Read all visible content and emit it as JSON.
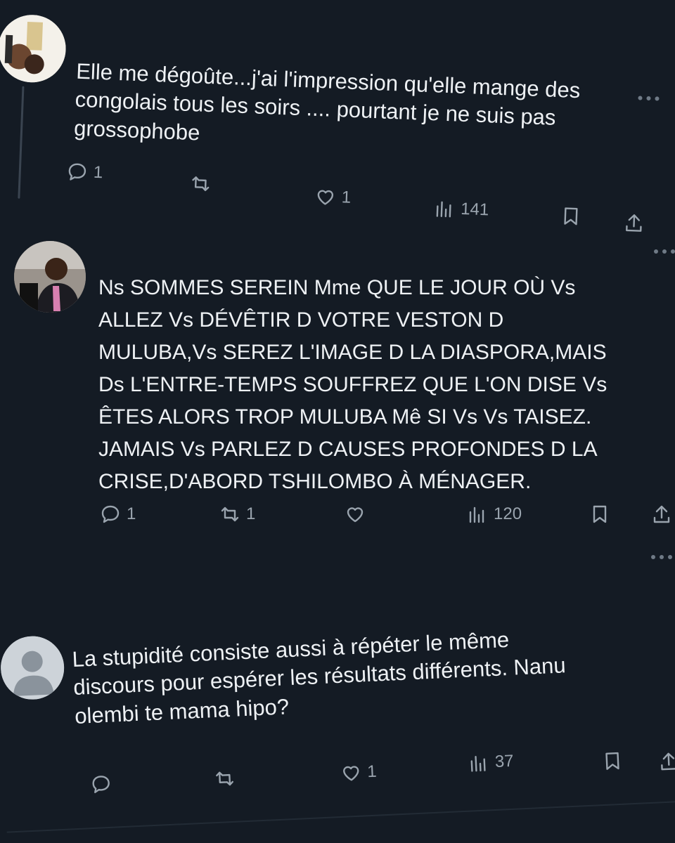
{
  "colors": {
    "background": "#141b24",
    "text": "#eef1f4",
    "icon": "#9aa4ae",
    "thread_line": "#3a4450"
  },
  "posts": [
    {
      "text": "Elle me dégoûte...j'ai l'impression qu'elle mange des\ncongolais tous les soirs .... pourtant je ne suis pas\ngrossophobe",
      "actions": {
        "reply_icon": "speech-bubble-icon",
        "reply_count": "1",
        "repost_icon": "repost-arrows-icon",
        "repost_count": "",
        "like_icon": "heart-icon",
        "like_count": "1",
        "views_icon": "bar-chart-icon",
        "views_count": "141",
        "bookmark_icon": "bookmark-icon",
        "share_icon": "share-arrow-icon"
      }
    },
    {
      "text": "Ns SOMMES SEREIN Mme QUE LE JOUR OÙ Vs\nALLEZ Vs DÉVÊTIR D VOTRE VESTON D\nMULUBA,Vs SEREZ L'IMAGE D LA DIASPORA,MAIS\nDs L'ENTRE-TEMPS SOUFFREZ QUE L'ON DISE Vs\nÊTES ALORS TROP MULUBA Mê SI Vs Vs TAISEZ.\nJAMAIS Vs PARLEZ D CAUSES PROFONDES D LA\nCRISE,D'ABORD TSHILOMBO À MÉNAGER.",
      "actions": {
        "reply_count": "1",
        "repost_count": "1",
        "like_count": "",
        "views_count": "120"
      }
    },
    {
      "text": "La stupidité consiste aussi à répéter le même\ndiscours pour espérer les résultats différents. Nanu\nolembi te mama hipo?",
      "actions": {
        "reply_count": "",
        "repost_count": "",
        "like_count": "1",
        "views_count": "37"
      }
    }
  ]
}
